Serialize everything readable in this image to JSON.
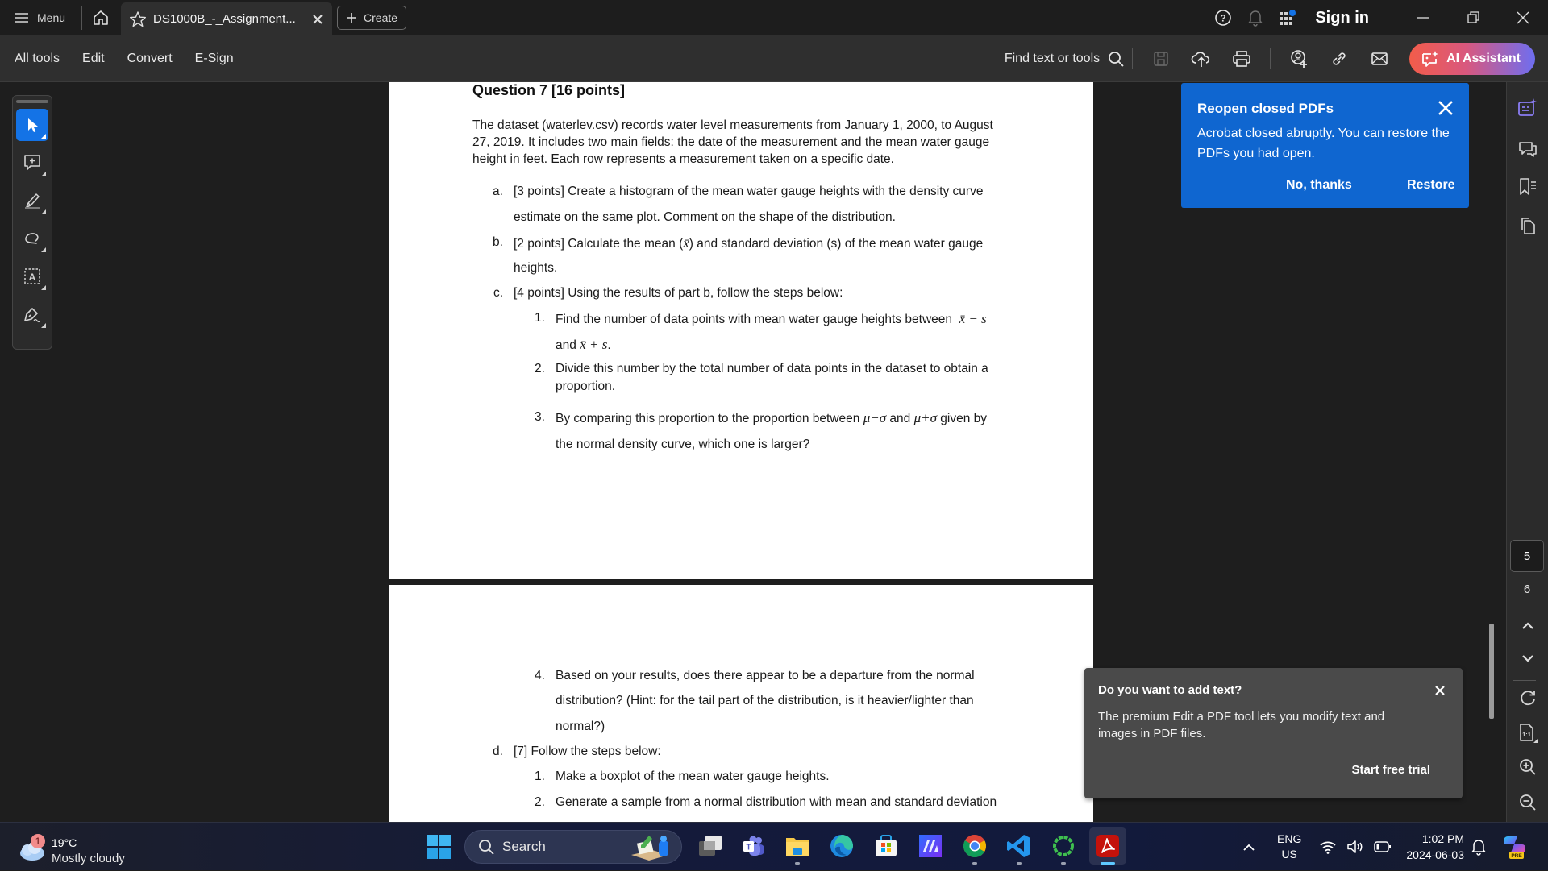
{
  "titlebar": {
    "menu_label": "Menu",
    "tab_title": "DS1000B_-_Assignment...",
    "create_label": "Create",
    "sign_in_label": "Sign in"
  },
  "toolbar": {
    "menus": [
      "All tools",
      "Edit",
      "Convert",
      "E-Sign"
    ],
    "find_label": "Find text or tools",
    "ai_assistant_label": "AI Assistant"
  },
  "document": {
    "question_title": "Question 7 [16 points]",
    "intro": "The dataset (waterlev.csv) records water level measurements from January 1, 2000, to August 27, 2019. It includes two main fields: the date of the measurement and the mean water gauge height in feet. Each row represents a measurement taken on a specific date.",
    "part_a": {
      "marker": "a.",
      "line1": "[3 points] Create a histogram of the mean water gauge heights with the density curve",
      "line2": "estimate on the same plot. Comment on the shape of the distribution."
    },
    "part_b": {
      "marker": "b.",
      "line1_pre": "[2 points] Calculate the mean (",
      "xbar": "x̄",
      "line1_post": ") and standard deviation (s) of the mean water gauge",
      "line2": "heights."
    },
    "part_c": {
      "marker": "c.",
      "line1": "[4 points] Using the results of part b, follow the steps below:",
      "step1": {
        "marker": "1.",
        "line1": "Find the number of data points with mean water gauge heights between",
        "math1": "x̄ − s",
        "line2_pre": "and",
        "math2": "x̄ + s",
        "line2_post": "."
      },
      "step2": {
        "marker": "2.",
        "line1": "Divide this number by the total number of data points in the dataset to obtain a",
        "line2": "proportion."
      },
      "step3": {
        "marker": "3.",
        "line1_pre": "By comparing this proportion to the proportion between",
        "math1": "μ−σ",
        "mid": "and",
        "math2": "μ+σ",
        "line1_post": "given by",
        "line2": "the normal density curve, which one is larger?"
      },
      "step4": {
        "marker": "4.",
        "line1": "Based on your results, does there appear to be a departure from the normal",
        "line2": "distribution? (Hint: for the tail part of the distribution, is it heavier/lighter than",
        "line3": "normal?)"
      }
    },
    "part_d": {
      "marker": "d.",
      "line1": "[7] Follow the steps below:",
      "step1": {
        "marker": "1.",
        "text": "Make a boxplot of the mean water gauge heights."
      },
      "step2": {
        "marker": "2.",
        "text": "Generate a sample from a normal distribution with mean and standard deviation"
      }
    }
  },
  "reopen_popup": {
    "title": "Reopen closed PDFs",
    "body": "Acrobat closed abruptly. You can restore the PDFs you had open.",
    "decline_label": "No, thanks",
    "restore_label": "Restore"
  },
  "edit_popup": {
    "title": "Do you want to add text?",
    "body": "The premium Edit a PDF tool lets you modify text and images in PDF files.",
    "cta_label": "Start free trial"
  },
  "page_nav": {
    "current_page": "5",
    "next_page": "6"
  },
  "colors": {
    "accent": "#1473e6",
    "popup_blue": "#0f66d0",
    "ai_purple": "#8a7cf2"
  },
  "taskbar": {
    "weather": {
      "temp": "19°C",
      "condition": "Mostly cloudy",
      "badge": "1"
    },
    "search_label": "Search",
    "apps": [
      "task-view",
      "teams",
      "file-explorer",
      "edge",
      "microsoft-store",
      "app-ma",
      "chrome",
      "vs-code",
      "app-ring",
      "acrobat"
    ],
    "language": {
      "line1": "ENG",
      "line2": "US"
    },
    "time": "1:02 PM",
    "date": "2024-06-03",
    "copilot_badge": "PRE"
  }
}
